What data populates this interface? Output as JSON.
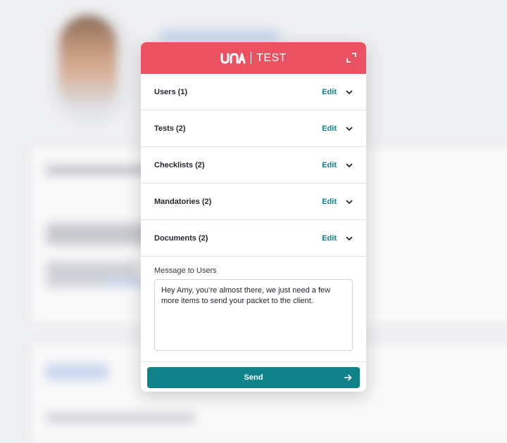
{
  "dialog": {
    "brand_logo": "una",
    "brand_product": "TEST",
    "expand_icon": "expand-icon",
    "sections": [
      {
        "label": "Users (1)",
        "edit_label": "Edit"
      },
      {
        "label": "Tests (2)",
        "edit_label": "Edit"
      },
      {
        "label": "Checklists (2)",
        "edit_label": "Edit"
      },
      {
        "label": "Mandatories (2)",
        "edit_label": "Edit"
      },
      {
        "label": "Documents (2)",
        "edit_label": "Edit"
      }
    ],
    "message": {
      "label": "Message to Users",
      "value": "Hey Amy, you’re almost there, we just need a few more items to send your packet to the client."
    },
    "send_label": "Send"
  },
  "colors": {
    "header": "#ea5262",
    "accent": "#12838a",
    "send_button": "#10838a"
  }
}
